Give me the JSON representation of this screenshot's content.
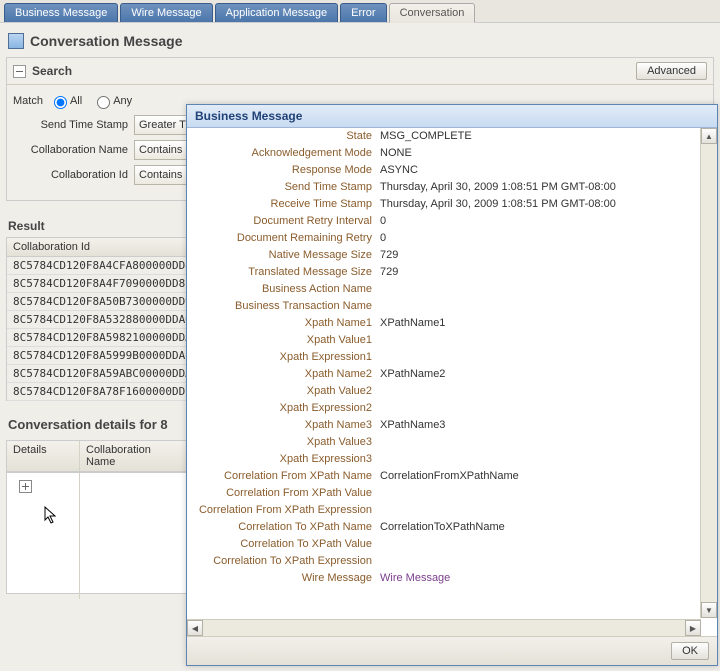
{
  "tabs": [
    "Business Message",
    "Wire Message",
    "Application Message",
    "Error",
    "Conversation"
  ],
  "activeTab": "Conversation",
  "pageTitle": "Conversation Message",
  "searchPanel": {
    "title": "Search",
    "advanced": "Advanced",
    "matchLabel": "Match",
    "matchOptions": {
      "all": "All",
      "any": "Any"
    },
    "matchSelected": "all",
    "fields": [
      {
        "label": "Send Time Stamp",
        "op": "Greater Than"
      },
      {
        "label": "Collaboration Name",
        "op": "Contains"
      },
      {
        "label": "Collaboration Id",
        "op": "Contains"
      }
    ]
  },
  "result": {
    "title": "Result",
    "columnHeader": "Collaboration Id",
    "rows": [
      "8C5784CD120F8A4CFA800000DD8F9",
      "8C5784CD120F8A4F7090000DD8F9",
      "8C5784CD120F8A50B7300000DD9B",
      "8C5784CD120F8A532880000DDA0",
      "8C5784CD120F8A5982100000DDAA",
      "8C5784CD120F8A5999B0000DDAB",
      "8C5784CD120F8A59ABC00000DDAC",
      "8C5784CD120F8A78F1600000DDB5"
    ]
  },
  "detailsSection": {
    "title": "Conversation details for 8",
    "columns": [
      "Details",
      "Collaboration Name"
    ]
  },
  "modal": {
    "title": "Business Message",
    "ok": "OK",
    "fields": [
      {
        "k": "State",
        "v": "MSG_COMPLETE"
      },
      {
        "k": "Acknowledgement Mode",
        "v": "NONE"
      },
      {
        "k": "Response Mode",
        "v": "ASYNC"
      },
      {
        "k": "Send Time Stamp",
        "v": "Thursday, April 30, 2009 1:08:51 PM GMT-08:00"
      },
      {
        "k": "Receive Time Stamp",
        "v": "Thursday, April 30, 2009 1:08:51 PM GMT-08:00"
      },
      {
        "k": "Document Retry Interval",
        "v": "0"
      },
      {
        "k": "Document Remaining Retry",
        "v": "0"
      },
      {
        "k": "Native Message Size",
        "v": "729"
      },
      {
        "k": "Translated Message Size",
        "v": "729"
      },
      {
        "k": "Business Action Name",
        "v": ""
      },
      {
        "k": "Business Transaction Name",
        "v": ""
      },
      {
        "k": "Xpath Name1",
        "v": "XPathName1"
      },
      {
        "k": "Xpath Value1",
        "v": ""
      },
      {
        "k": "Xpath Expression1",
        "v": ""
      },
      {
        "k": "Xpath Name2",
        "v": "XPathName2"
      },
      {
        "k": "Xpath Value2",
        "v": ""
      },
      {
        "k": "Xpath Expression2",
        "v": ""
      },
      {
        "k": "Xpath Name3",
        "v": "XPathName3"
      },
      {
        "k": "Xpath Value3",
        "v": ""
      },
      {
        "k": "Xpath Expression3",
        "v": ""
      },
      {
        "k": "Correlation From XPath Name",
        "v": "CorrelationFromXPathName"
      },
      {
        "k": "Correlation From XPath Value",
        "v": ""
      },
      {
        "k": "Correlation From XPath Expression",
        "v": ""
      },
      {
        "k": "Correlation To XPath Name",
        "v": "CorrelationToXPathName"
      },
      {
        "k": "Correlation To XPath Value",
        "v": ""
      },
      {
        "k": "Correlation To XPath Expression",
        "v": ""
      },
      {
        "k": "Wire Message",
        "v": "Wire Message",
        "link": true
      }
    ]
  }
}
